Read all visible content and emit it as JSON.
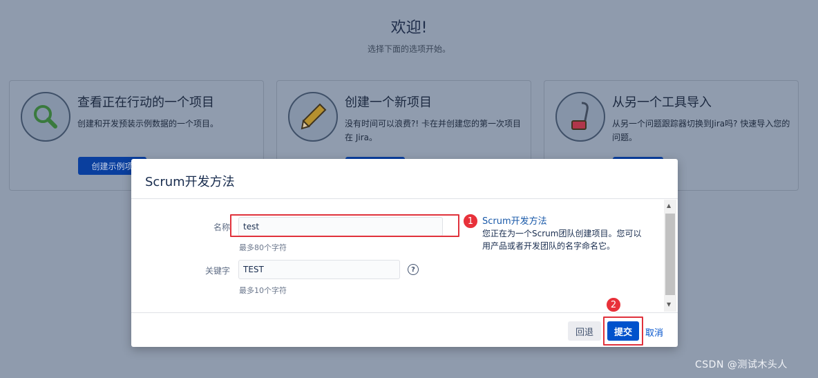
{
  "welcome": {
    "title": "欢迎!",
    "subtitle": "选择下面的选项开始。"
  },
  "cards": [
    {
      "title": "查看正在行动的一个项目",
      "description": "创建和开发预装示例数据的一个项目。",
      "button": "创建示例项",
      "icon": "magnifier-icon"
    },
    {
      "title": "创建一个新项目",
      "description": "没有时间可以浪费?! 卡在并创建您的第一次项目在 Jira。",
      "button": "",
      "icon": "pencil-icon"
    },
    {
      "title": "从另一个工具导入",
      "description": "从另一个问题跟踪器切换到Jira吗? 快速导入您的问题。",
      "button": "",
      "icon": "vacuum-icon"
    }
  ],
  "modal": {
    "title": "Scrum开发方法",
    "name_label": "名称",
    "name_value": "test",
    "name_hint": "最多80个字符",
    "key_label": "关键字",
    "key_value": "TEST",
    "key_hint": "最多10个字符",
    "help_glyph": "?",
    "info_title": "Scrum开发方法",
    "info_desc": "您正在为一个Scrum团队创建项目。您可以用产品或者开发团队的名字命名它。",
    "back_button": "回退",
    "submit_button": "提交",
    "cancel_link": "取消"
  },
  "markers": [
    "1",
    "2"
  ],
  "watermark": "CSDN @测试木头人",
  "colors": {
    "overlay": "#8f9bad",
    "primary": "#0052cc",
    "highlight": "#e0313b"
  }
}
